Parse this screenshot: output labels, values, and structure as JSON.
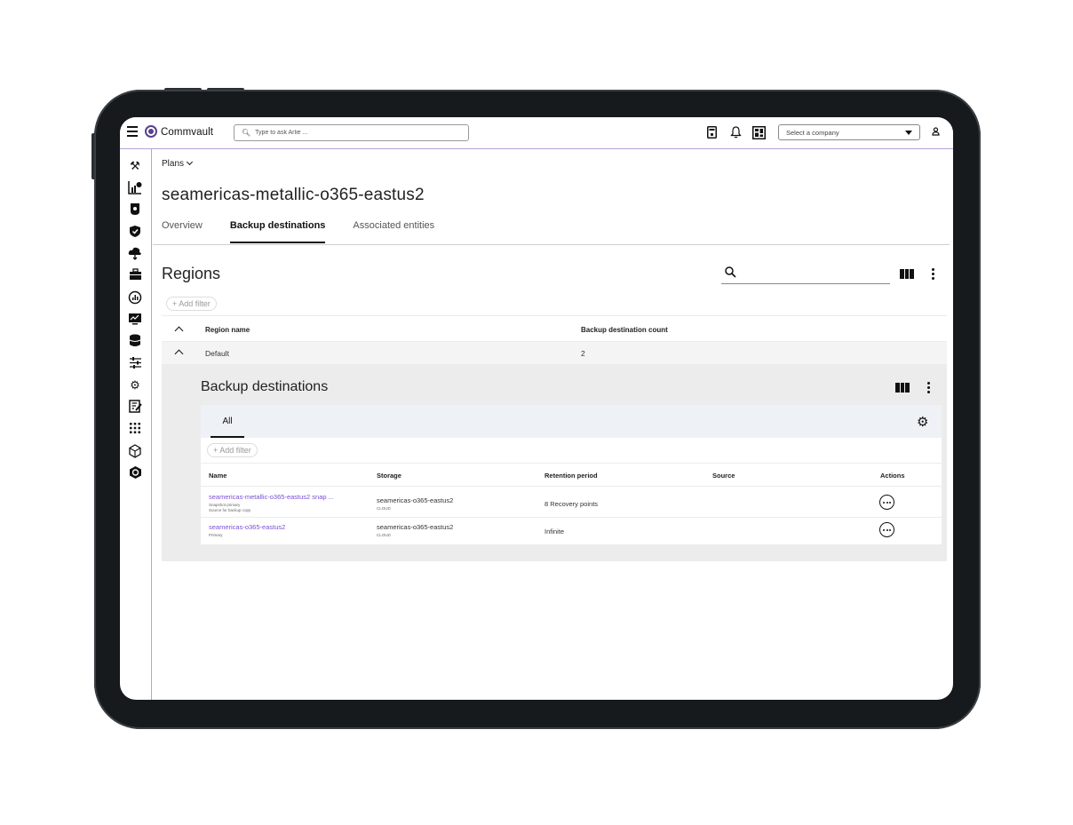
{
  "topbar": {
    "app_name": "Commvault",
    "ask_placeholder": "Type to ask Arlie ...",
    "company_select_value": "Select a company"
  },
  "breadcrumb": {
    "label": "Plans"
  },
  "page": {
    "title": "seamericas-metallic-o365-eastus2"
  },
  "tabs": [
    {
      "label": "Overview"
    },
    {
      "label": "Backup destinations"
    },
    {
      "label": "Associated entities"
    }
  ],
  "regions": {
    "title": "Regions",
    "add_filter": "+ Add filter",
    "columns": [
      "Region name",
      "Backup destination count"
    ],
    "rows": [
      {
        "name": "Default",
        "count": "2"
      }
    ]
  },
  "backup_destinations": {
    "title": "Backup destinations",
    "tab_all": "All",
    "add_filter": "+ Add filter",
    "columns": [
      "Name",
      "Storage",
      "Retention period",
      "Source",
      "Actions"
    ],
    "rows": [
      {
        "name": "seamericas-metallic-o365-eastus2 snap ...",
        "sub1": "Snapshot primary",
        "sub2": "Source for backup copy",
        "storage": "seamericas-o365-eastus2",
        "storage_type": "CLOUD",
        "retention": "8 Recovery points",
        "source": ""
      },
      {
        "name": "seamericas-o365-eastus2",
        "sub1": "Primary",
        "sub2": "",
        "storage": "seamericas-o365-eastus2",
        "storage_type": "CLOUD",
        "retention": "Infinite",
        "source": ""
      }
    ]
  },
  "colors": {
    "accent": "#7a4fd6",
    "brand": "#5a3f8f",
    "frame": "#161a1d"
  },
  "icons": {
    "left_nav": [
      "tools-icon",
      "reports-icon",
      "security-icon",
      "shield-icon",
      "cloud-restore-icon",
      "briefcase-icon",
      "analytics-icon",
      "monitor-icon",
      "database-icon",
      "sliders-icon",
      "gear-cog-icon",
      "edit-report-icon",
      "apps-grid-icon",
      "cube-icon",
      "hexagon-icon"
    ]
  }
}
